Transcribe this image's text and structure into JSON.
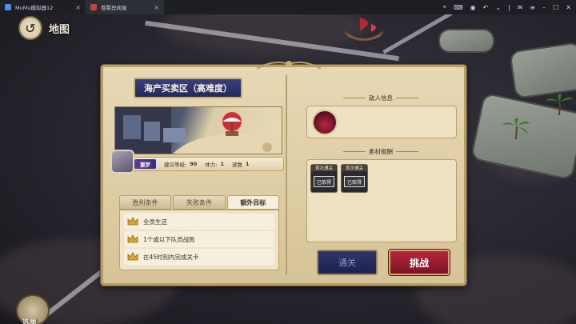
{
  "window": {
    "tabs": [
      {
        "label": "MuMu模拟器12"
      },
      {
        "label": "苍雾异闻录"
      }
    ]
  },
  "nav": {
    "map_label": "地图",
    "menu_label": "选单"
  },
  "stage": {
    "title": "海产买卖区（高难度）",
    "difficulty": "噩梦",
    "level_label": "建议等级:",
    "level": "90",
    "stamina_label": "体力:",
    "stamina": "1",
    "waves_label": "波数",
    "waves": "1"
  },
  "condition_tabs": [
    {
      "label": "胜利条件"
    },
    {
      "label": "失败条件"
    },
    {
      "label": "额外目标"
    }
  ],
  "conditions": [
    {
      "text": "全员生还"
    },
    {
      "text": "1个或以下队员战败"
    },
    {
      "text": "在45时刻内完成关卡"
    }
  ],
  "enemy_section": {
    "label": "敌人信息"
  },
  "material_section": {
    "label": "素材报酬",
    "items": [
      {
        "top": "首次通关",
        "stamp": "已取得"
      },
      {
        "top": "首次通关",
        "stamp": "已取得"
      }
    ]
  },
  "actions": {
    "clear": "通关",
    "challenge": "挑战"
  },
  "colors": {
    "title_bg": "#2c3170",
    "challenge_red": "#a11f33",
    "clear_blue": "#232858",
    "difficulty_purple": "#4a3590"
  }
}
